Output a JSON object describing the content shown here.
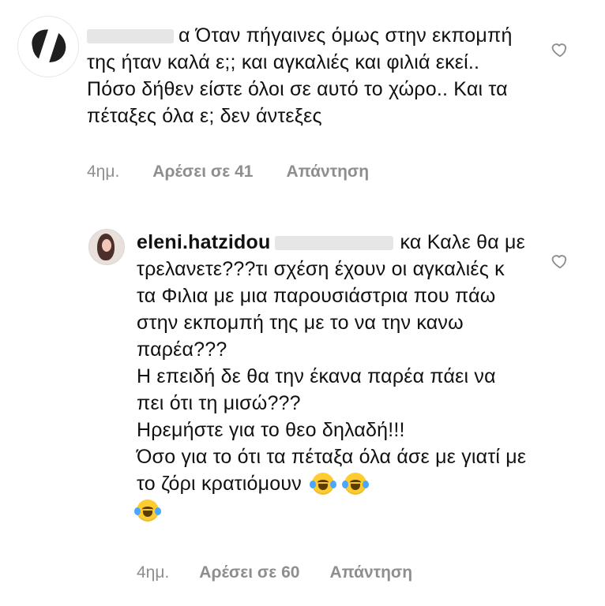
{
  "comments": [
    {
      "text": "α Όταν πήγαινες όμως στην εκπομπή της ήταν καλά ε;; και αγκαλιές και φιλιά εκεί.. Πόσο δήθεν είστε όλοι σε αυτό το χώρο.. Και τα πέταξες όλα ε; δεν άντεξες",
      "meta": {
        "time": "4ημ.",
        "likes": "Αρέσει σε 41",
        "reply": "Απάντηση"
      },
      "like_icon": "heart-outline-icon"
    },
    {
      "username": "eleni.hatzidou",
      "mention_suffix": "κα",
      "text_lines": [
        "Καλε θα με τρελανετε???τι σχέση έχουν οι αγκαλιές κ τα Φιλια με μια παρουσιάστρια που πάω στην εκπομπή της με το να την κανω παρέα???",
        "Η επειδή δε θα την έκανα παρέα πάει να πει ότι τη μισώ???",
        "Ηρεμήστε για το θεο δηλαδή!!!",
        "Όσο για το ότι τα πέταξα όλα άσε με γιατί με το ζόρι κρατιόμουν"
      ],
      "emoji": "face-with-tears-of-joy-emoji",
      "meta": {
        "time": "4ημ.",
        "likes": "Αρέσει σε 60",
        "reply": "Απάντηση"
      },
      "like_icon": "heart-outline-icon"
    }
  ],
  "colors": {
    "text": "#111111",
    "meta": "#8e8e8e",
    "background": "#ffffff"
  }
}
